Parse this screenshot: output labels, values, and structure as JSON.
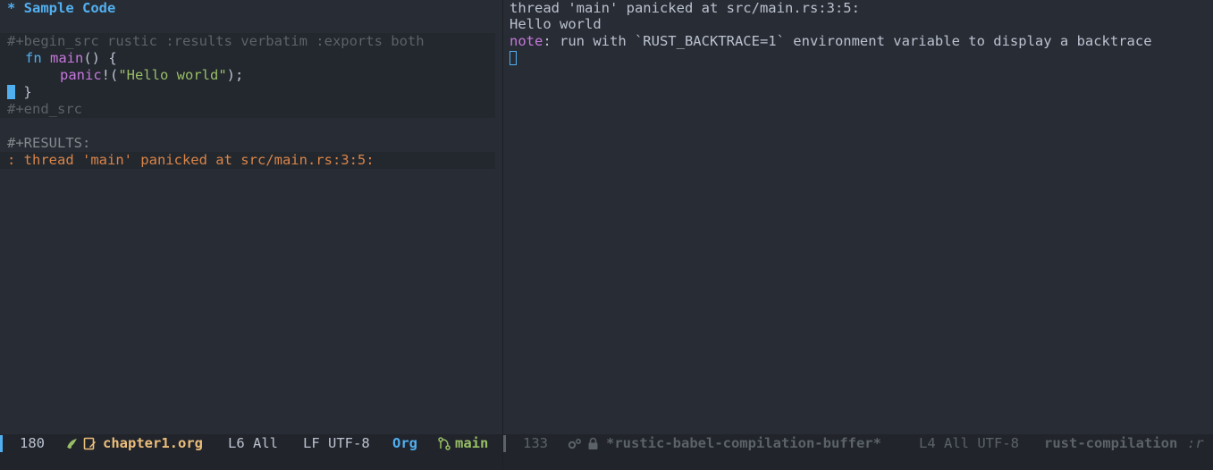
{
  "left_buffer": {
    "heading": "* Sample Code",
    "begin_src": "#+begin_src rustic :results verbatim :exports both",
    "code": {
      "kw_fn": "fn",
      "fn_name": "main",
      "sig_rest": "() {",
      "panic_macro": "panic",
      "bang_paren": "!(",
      "string": "\"Hello world\"",
      "call_end": ");",
      "close_brace": "}"
    },
    "end_src": "#+end_src",
    "results_label": "#+RESULTS:",
    "result_line": ": thread 'main' panicked at src/main.rs:3:5:"
  },
  "right_buffer": {
    "line1": "thread 'main' panicked at src/main.rs:3:5:",
    "line2": "Hello world",
    "note_label": "note",
    "note_text": ": run with `RUST_BACKTRACE=1` environment variable to display a backtrace"
  },
  "modeline_left": {
    "size": "180",
    "filename": "chapter1.org",
    "position": "L6 All",
    "encoding": "LF UTF-8",
    "major_mode": "Org",
    "branch": "main"
  },
  "modeline_right": {
    "size": "133",
    "buffer_name": "*rustic-babel-compilation-buffer*",
    "position": "L4 All UTF-8",
    "major_mode": "rust-compilation",
    "minor_mode": ":r"
  },
  "icons": [
    "rust-icon",
    "file-edit-icon",
    "git-branch-icon",
    "gear-icon",
    "lock-icon"
  ],
  "colors": {
    "background": "#282c34",
    "accent_blue": "#51afef",
    "keyword_purple": "#c678dd",
    "string_green": "#98be65",
    "result_orange": "#da8548",
    "filename_yellow": "#ecbe7b"
  }
}
